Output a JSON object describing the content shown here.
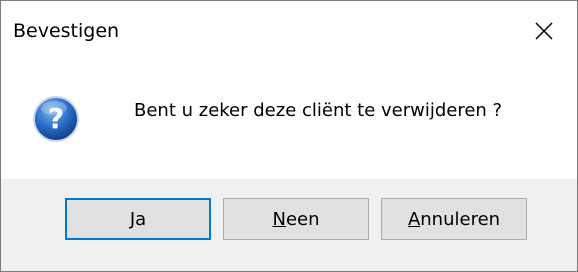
{
  "window": {
    "title": "Bevestigen",
    "close_icon": "close-icon"
  },
  "message": {
    "icon": "question-icon",
    "text": "Bent u zeker deze cliënt te verwijderen ?"
  },
  "buttons": {
    "yes": {
      "access_key": "J",
      "rest": "a"
    },
    "no": {
      "access_key": "N",
      "rest": "een"
    },
    "cancel": {
      "access_key": "A",
      "rest": "nnuleren"
    }
  },
  "colors": {
    "accent": "#0078d7",
    "button_face": "#e1e1e1",
    "dialog_bg": "#f0f0f0"
  }
}
